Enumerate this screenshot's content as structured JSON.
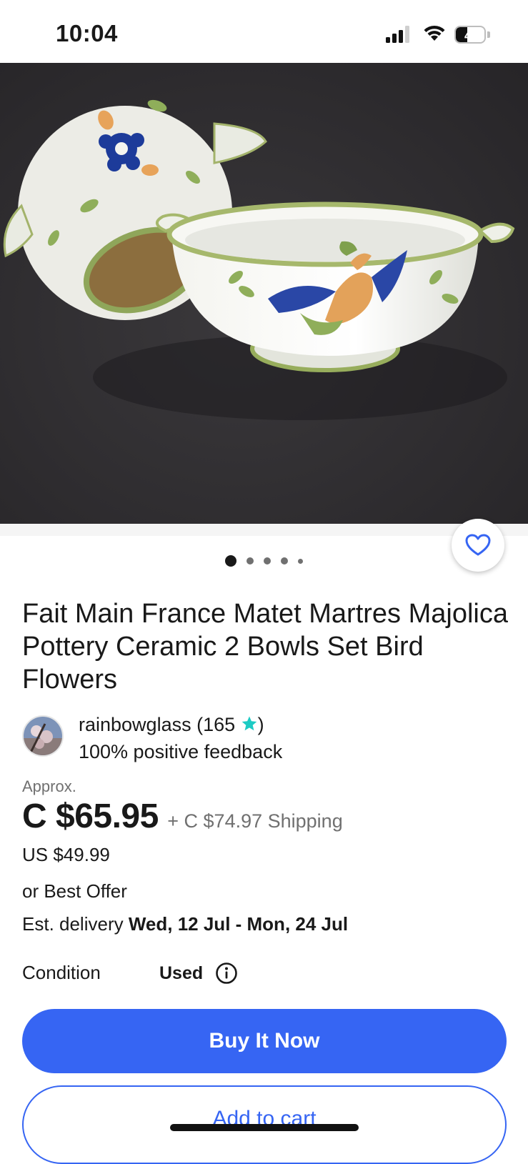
{
  "status_bar": {
    "time": "10:04",
    "battery_level": "40",
    "battery_fraction": 0.4
  },
  "listing": {
    "title": "Fait Main France Matet Martres Majolica Pottery Ceramic 2 Bowls Set Bird Flowers",
    "image_count": 5,
    "active_image_index": 1
  },
  "seller": {
    "name": "rainbowglass",
    "rating_open": "(165",
    "rating_close": ")",
    "feedback": "100% positive feedback"
  },
  "pricing": {
    "approx_label": "Approx.",
    "price": "C $65.95",
    "shipping": "+ C $74.97 Shipping",
    "usd_price": "US $49.99",
    "best_offer": "or Best Offer"
  },
  "delivery": {
    "label": "Est. delivery",
    "dates": "Wed, 12 Jul - Mon, 24 Jul"
  },
  "condition": {
    "label": "Condition",
    "value": "Used"
  },
  "actions": {
    "buy_now": "Buy It Now",
    "add_to_cart": "Add to cart"
  },
  "icons": {
    "favorite": "heart-outline-icon",
    "info": "info-circle-icon",
    "star": "teal-star-icon",
    "signal": "cellular-signal-icon",
    "wifi": "wifi-icon",
    "battery": "battery-icon"
  },
  "colors": {
    "accent": "#3665f3",
    "star": "#1dcbc4",
    "text_secondary": "#707070"
  }
}
